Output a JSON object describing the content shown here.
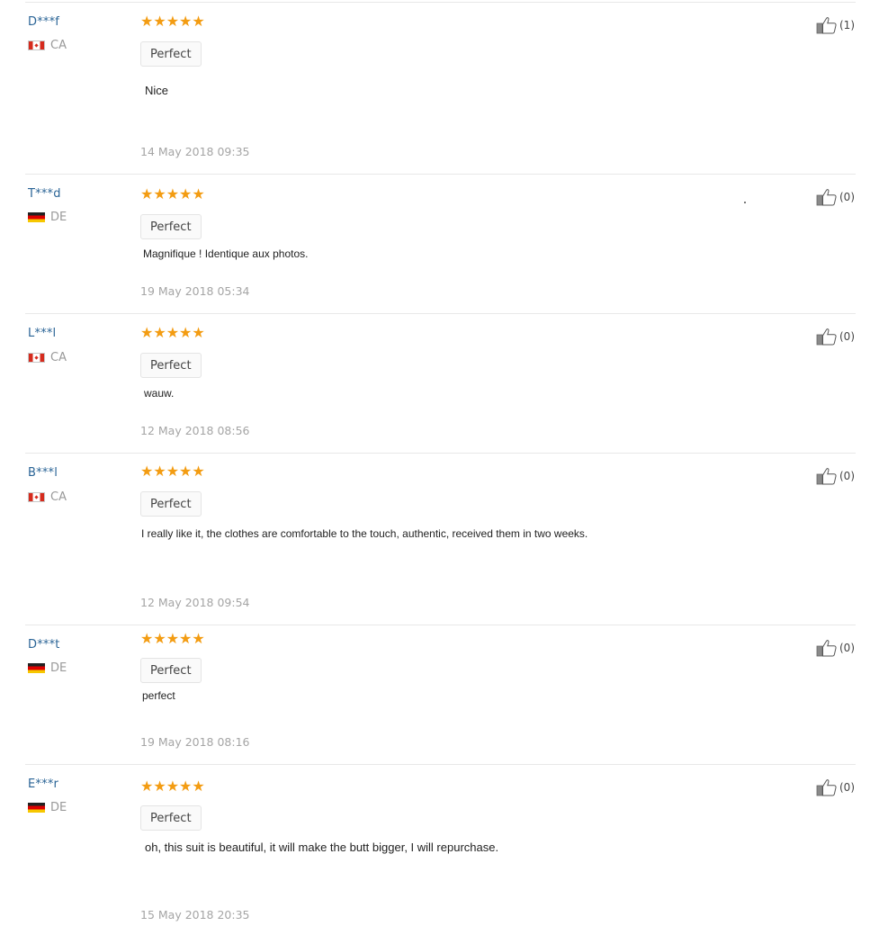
{
  "reviews": [
    {
      "user": "D***f",
      "country": "CA",
      "flag": "canada-flag-icon",
      "stars": "★★★★★",
      "rating": 5,
      "tag": "Perfect",
      "text": "Nice",
      "date": "14 May 2018 09:35",
      "helpful": "(1)"
    },
    {
      "user": "T***d",
      "country": "DE",
      "flag": "germany-flag-icon",
      "stars": "★★★★★",
      "rating": 5,
      "tag": "Perfect",
      "text": "Magnifique ! Identique aux photos.",
      "date": "19 May 2018 05:34",
      "helpful": "(0)"
    },
    {
      "user": "L***l",
      "country": "CA",
      "flag": "canada-flag-icon",
      "stars": "★★★★★",
      "rating": 5,
      "tag": "Perfect",
      "text": "wauw.",
      "date": "12 May 2018 08:56",
      "helpful": "(0)"
    },
    {
      "user": "B***l",
      "country": "CA",
      "flag": "canada-flag-icon",
      "stars": "★★★★★",
      "rating": 5,
      "tag": "Perfect",
      "text": "I really like it, the clothes are comfortable to the touch, authentic, received them in two weeks.",
      "date": "12 May 2018 09:54",
      "helpful": "(0)"
    },
    {
      "user": "D***t",
      "country": "DE",
      "flag": "germany-flag-icon",
      "stars": "★★★★★",
      "rating": 5,
      "tag": "Perfect",
      "text": "perfect",
      "date": "19 May 2018 08:16",
      "helpful": "(0)"
    },
    {
      "user": "E***r",
      "country": "DE",
      "flag": "germany-flag-icon",
      "stars": "★★★★★",
      "rating": 5,
      "tag": "Perfect",
      "text": "oh, this suit is beautiful, it will make the butt bigger, I will repurchase.",
      "date": "15 May 2018 20:35",
      "helpful": "(0)"
    }
  ],
  "colors": {
    "user_link": "#2a6496",
    "star": "#f39c12",
    "date": "#a5a5a5",
    "divider": "#e8e8e8"
  },
  "icons": {
    "helpful": "thumbs-up-icon"
  }
}
